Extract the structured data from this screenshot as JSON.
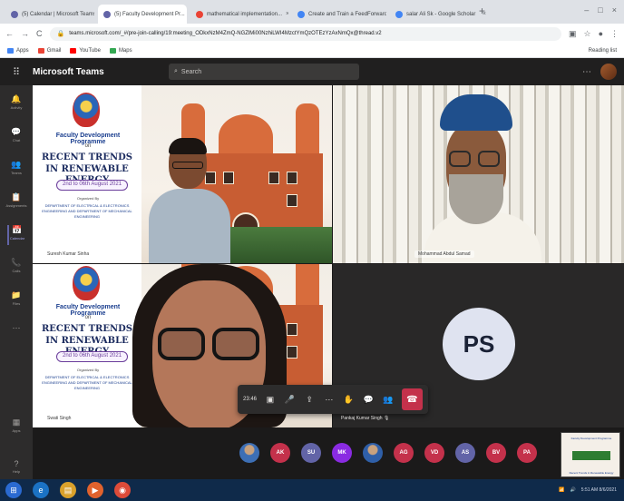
{
  "browser": {
    "tabs": [
      {
        "label": "(5) Calendar | Microsoft Teams",
        "color": "#6264a7"
      },
      {
        "label": "(5) Faculty Development Pr...",
        "color": "#6264a7",
        "active": true
      },
      {
        "label": "mathematical implementation...",
        "color": "#ea4335"
      },
      {
        "label": "Create and Train a FeedForward...",
        "color": "#4285f4"
      },
      {
        "label": "salar Ali Sk - Google Scholar",
        "color": "#4285f4"
      }
    ],
    "new_tab": "+",
    "url": "teams.microsoft.com/_#/pre-join-calling/19:meeting_ODkxNzM4ZmQ-NGZlMi00NzhiLWI4MzctYmQzOTEzYzAxNmQx@thread.v2",
    "bookmarks": [
      {
        "label": "Apps",
        "color": "#4285f4"
      },
      {
        "label": "Gmail",
        "color": "#ea4335"
      },
      {
        "label": "YouTube",
        "color": "#ff0000"
      },
      {
        "label": "Maps",
        "color": "#34a853"
      }
    ],
    "reading_list": "Reading list"
  },
  "teams": {
    "app_title": "Microsoft Teams",
    "search_placeholder": "Search",
    "rail": [
      {
        "icon": "activity-icon",
        "glyph": "🔔",
        "label": "Activity"
      },
      {
        "icon": "chat-icon",
        "glyph": "💬",
        "label": "Chat"
      },
      {
        "icon": "teams-icon",
        "glyph": "👥",
        "label": "Teams"
      },
      {
        "icon": "assignments-icon",
        "glyph": "📋",
        "label": "Assignments"
      },
      {
        "icon": "calendar-icon",
        "glyph": "📅",
        "label": "Calendar",
        "active": true
      },
      {
        "icon": "calls-icon",
        "glyph": "📞",
        "label": "Calls"
      },
      {
        "icon": "files-icon",
        "glyph": "📁",
        "label": "Files"
      },
      {
        "icon": "more-apps-icon",
        "glyph": "⋯",
        "label": ""
      }
    ],
    "rail_bottom": [
      {
        "icon": "apps-icon",
        "glyph": "▦",
        "label": "Apps"
      },
      {
        "icon": "help-icon",
        "glyph": "?",
        "label": "Help"
      }
    ]
  },
  "poster": {
    "programme": "Faculty Development Programme",
    "on": "on",
    "title_line1": "RECENT TRENDS",
    "title_line2": "IN RENEWABLE ENERGY",
    "dates": "2nd to 06th August 2021",
    "organized_by": "Organized By",
    "department": "DEPARTMENT OF ELECTRICAL & ELECTRONICS ENGINEERING AND DEPARTMENT OF MECHANICAL ENGINEERING"
  },
  "tiles": {
    "tl_name": "Suresh Kumar Sinha",
    "tr_name": "Mohammad Abdul Samad",
    "bl_name": "Swati Singh",
    "br_initials": "PS"
  },
  "controls": {
    "timer": "23:46",
    "speaker": "Pankaj Kumar Singh"
  },
  "participants": [
    {
      "initials": "",
      "color": "#3d6fb5",
      "photo": true
    },
    {
      "initials": "AK",
      "color": "#c4314b"
    },
    {
      "initials": "SU",
      "color": "#6264a7"
    },
    {
      "initials": "MK",
      "color": "#8a2be2"
    },
    {
      "initials": "",
      "color": "#2f5fa8",
      "photo": true
    },
    {
      "initials": "AG",
      "color": "#c4314b"
    },
    {
      "initials": "VD",
      "color": "#c4314b"
    },
    {
      "initials": "AS",
      "color": "#6264a7"
    },
    {
      "initials": "BV",
      "color": "#c4314b"
    },
    {
      "initials": "PA",
      "color": "#c4314b"
    }
  ],
  "thumb_poster": {
    "line1": "Faculty Development Programme",
    "line2": "Recent Trends in Renewable Energy"
  },
  "taskbar": {
    "time": "5:51 AM",
    "date": "8/6/2021"
  }
}
